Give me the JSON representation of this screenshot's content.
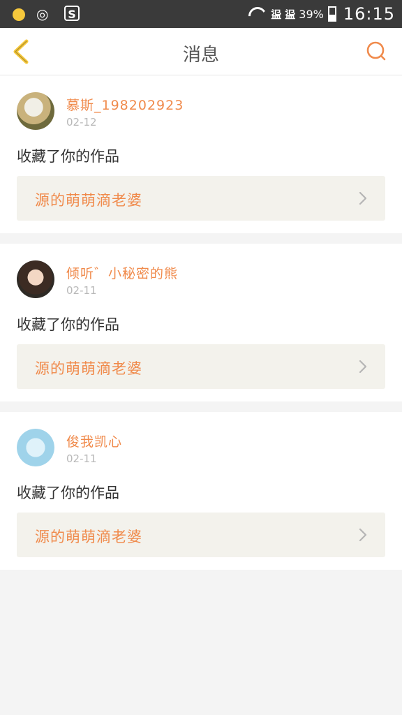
{
  "statusbar": {
    "signal_1": "䀀",
    "signal_2": "䀀",
    "battery": "39%",
    "time": "16:15"
  },
  "nav": {
    "title": "消息"
  },
  "messages": [
    {
      "username": "慕斯_198202923",
      "date": "02-12",
      "action": "收藏了你的作品",
      "work_title": "源的萌萌滴老婆"
    },
    {
      "username": "倾听゛小秘密的熊",
      "date": "02-11",
      "action": "收藏了你的作品",
      "work_title": "源的萌萌滴老婆"
    },
    {
      "username": "俊我凯心",
      "date": "02-11",
      "action": "收藏了你的作品",
      "work_title": "源的萌萌滴老婆"
    }
  ],
  "colors": {
    "accent": "#f08a4b",
    "back_arrow": "#f6c83c",
    "card_bg": "#ffffff",
    "page_bg": "#f4f4f4",
    "work_bg": "#f3f2ec"
  }
}
